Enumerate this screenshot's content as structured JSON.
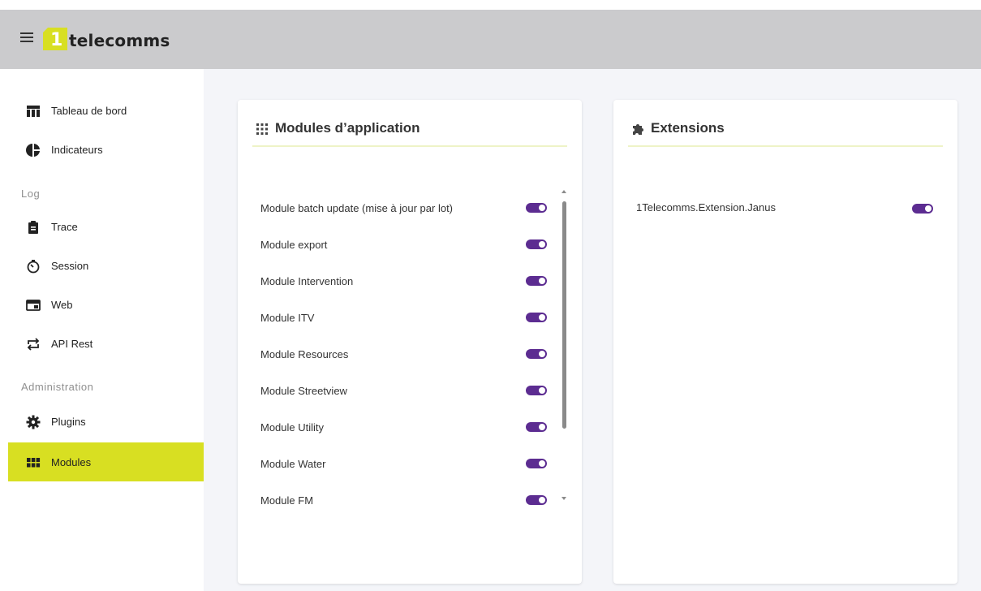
{
  "header": {
    "menu_icon": "hamburger-menu-icon",
    "logo": {
      "mark": "1",
      "text": "telecomms"
    },
    "colors": {
      "header_bg": "#cbcbcd",
      "brand": "#d8df22"
    }
  },
  "sidebar": {
    "items": [
      {
        "label": "Tableau de bord",
        "icon": "dashboard-table-icon"
      },
      {
        "label": "Indicateurs",
        "icon": "pie-chart-icon"
      }
    ],
    "log_section": {
      "title": "Log",
      "items": [
        {
          "label": "Trace",
          "icon": "clipboard-icon"
        },
        {
          "label": "Session",
          "icon": "timer-icon"
        },
        {
          "label": "Web",
          "icon": "browser-window-icon"
        },
        {
          "label": "API Rest",
          "icon": "repeat-arrows-icon"
        }
      ]
    },
    "admin_section": {
      "title": "Administration",
      "items": [
        {
          "label": "Plugins",
          "icon": "gear-icon"
        },
        {
          "label": "Modules",
          "icon": "grid-icon",
          "active": true
        }
      ]
    }
  },
  "modules_card": {
    "title": "Modules d’application",
    "icon": "apps-grid-icon",
    "items": [
      {
        "label": "Module batch update (mise à jour par lot)",
        "enabled": true
      },
      {
        "label": "Module export",
        "enabled": true
      },
      {
        "label": "Module Intervention",
        "enabled": true
      },
      {
        "label": "Module ITV",
        "enabled": true
      },
      {
        "label": "Module Resources",
        "enabled": true
      },
      {
        "label": "Module Streetview",
        "enabled": true
      },
      {
        "label": "Module Utility",
        "enabled": true
      },
      {
        "label": "Module Water",
        "enabled": true
      },
      {
        "label": "Module FM",
        "enabled": true
      }
    ]
  },
  "extensions_card": {
    "title": "Extensions",
    "icon": "puzzle-piece-icon",
    "items": [
      {
        "label": "1Telecomms.Extension.Janus",
        "enabled": true
      }
    ]
  },
  "toggle_color": "#5c2c91"
}
